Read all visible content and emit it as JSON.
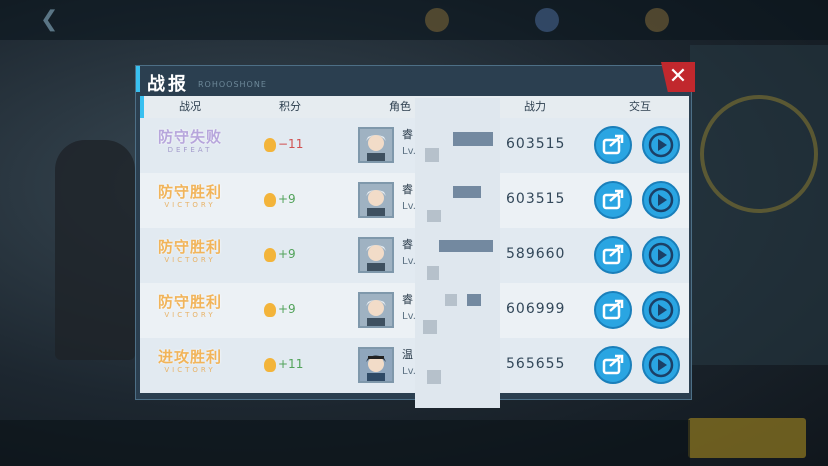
{
  "dialog": {
    "title": "战报",
    "subtitle": "ROHOOSHONE"
  },
  "table": {
    "headers": [
      "战况",
      "积分",
      "角色",
      "战力",
      "交互"
    ],
    "rows": [
      {
        "result": "防守失败",
        "result_en": "DEFEAT",
        "result_type": "defeat",
        "score": "−11",
        "score_sign": "neg",
        "name": "睿",
        "level": "Lv.4",
        "power": "603515"
      },
      {
        "result": "防守胜利",
        "result_en": "VICTORY",
        "result_type": "win",
        "score": "+9",
        "score_sign": "pos",
        "name": "睿",
        "level": "Lv.4",
        "power": "603515"
      },
      {
        "result": "防守胜利",
        "result_en": "VICTORY",
        "result_type": "win",
        "score": "+9",
        "score_sign": "pos",
        "name": "睿",
        "level": "Lv.",
        "power": "589660"
      },
      {
        "result": "防守胜利",
        "result_en": "VICTORY",
        "result_type": "win",
        "score": "+9",
        "score_sign": "pos",
        "name": "睿",
        "level": "Lv.",
        "power": "606999"
      },
      {
        "result": "进攻胜利",
        "result_en": "VICTORY",
        "result_type": "win",
        "score": "+11",
        "score_sign": "pos",
        "name": "温",
        "level": "Lv.",
        "power": "565655"
      }
    ]
  },
  "icons": {
    "share": "share-icon",
    "play": "play-icon",
    "close": "close-icon",
    "medal": "medal-icon"
  },
  "colors": {
    "accent": "#39c0f0",
    "close": "#c1282d",
    "button": "#2aa5e2",
    "defeat": "#b7a6dc",
    "victory": "#f1b45a"
  }
}
